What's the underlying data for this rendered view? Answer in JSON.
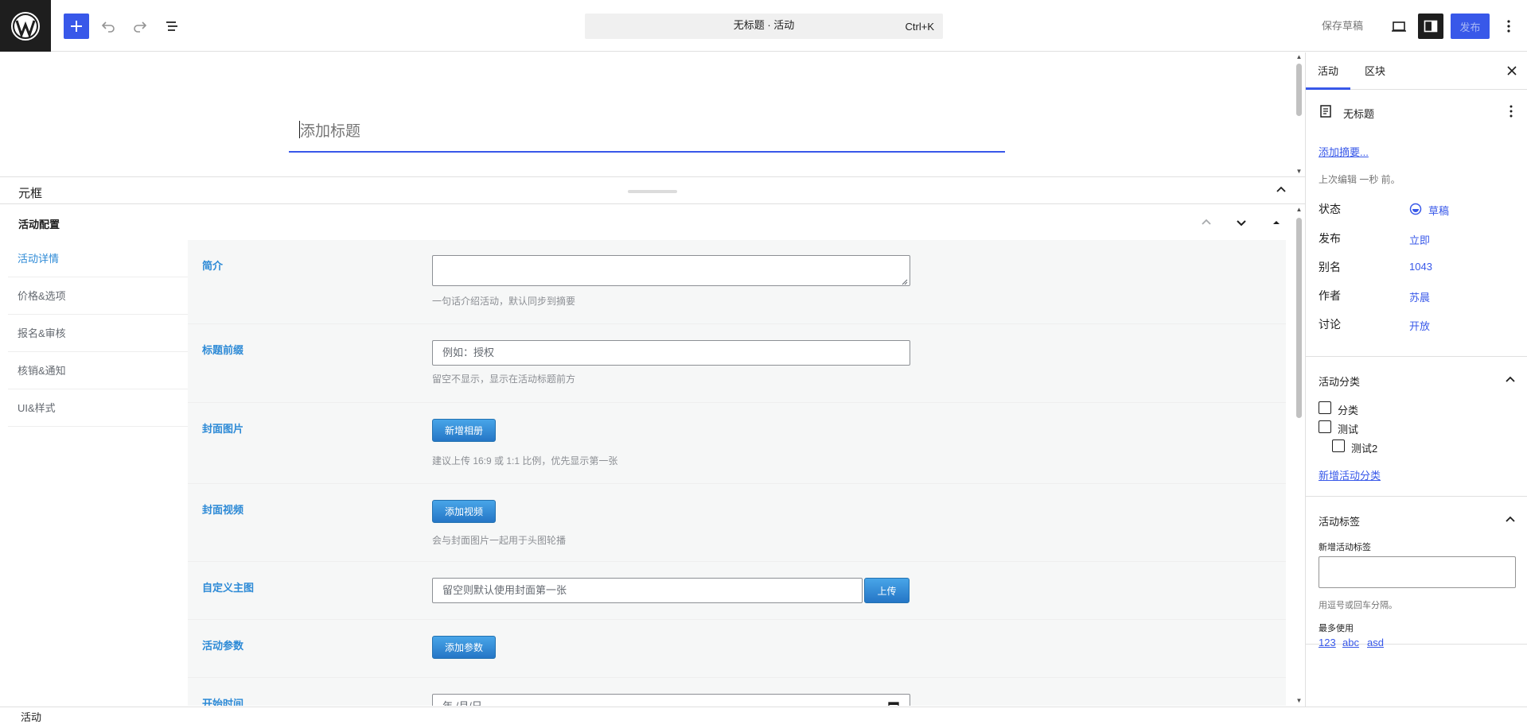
{
  "header": {
    "undo_label": "Undo",
    "redo_label": "Redo",
    "command_title": "无标题 · 活动",
    "command_shortcut": "Ctrl+K",
    "save_draft": "保存草稿",
    "publish": "发布"
  },
  "editor": {
    "title_placeholder": "添加标题"
  },
  "meta": {
    "header_title": "元框",
    "box_title": "活动配置",
    "tabs": [
      "活动详情",
      "价格&选项",
      "报名&审核",
      "核销&通知",
      "UI&样式"
    ],
    "fields": {
      "intro": {
        "label": "简介",
        "help": "一句话介绍活动，默认同步到摘要"
      },
      "prefix": {
        "label": "标题前缀",
        "placeholder": "例如：授权",
        "help": "留空不显示，显示在活动标题前方"
      },
      "cover_image": {
        "label": "封面图片",
        "button": "新增相册",
        "help": "建议上传 16:9 或 1:1 比例，优先显示第一张"
      },
      "cover_video": {
        "label": "封面视频",
        "button": "添加视频",
        "help": "会与封面图片一起用于头图轮播"
      },
      "custom_main": {
        "label": "自定义主图",
        "placeholder": "留空则默认使用封面第一张",
        "button": "上传"
      },
      "params": {
        "label": "活动参数",
        "button": "添加参数"
      },
      "start_time": {
        "label": "开始时间",
        "value": "年 /月/日"
      }
    }
  },
  "sidebar": {
    "tabs": [
      "活动",
      "区块"
    ],
    "post_title": "无标题",
    "add_excerpt": "添加摘要...",
    "last_edited": "上次编辑 一秒 前。",
    "rows": [
      {
        "label": "状态",
        "value": "草稿"
      },
      {
        "label": "发布",
        "value": "立即"
      },
      {
        "label": "别名",
        "value": "1043"
      },
      {
        "label": "作者",
        "value": "苏晨"
      },
      {
        "label": "讨论",
        "value": "开放"
      }
    ],
    "categories": {
      "title": "活动分类",
      "items": [
        "分类",
        "测试",
        "测试2"
      ],
      "add_link": "新增活动分类"
    },
    "tags": {
      "title": "活动标签",
      "new_label": "新增活动标签",
      "hint": "用逗号或回车分隔。",
      "most_used_label": "最多使用",
      "most_used": [
        "123",
        "abc",
        "asd"
      ]
    }
  },
  "footer": {
    "breadcrumb": "活动"
  },
  "colors": {
    "accent": "#3858e9",
    "metabox_link": "#2d8ad6",
    "dark": "#1e1e1e"
  }
}
